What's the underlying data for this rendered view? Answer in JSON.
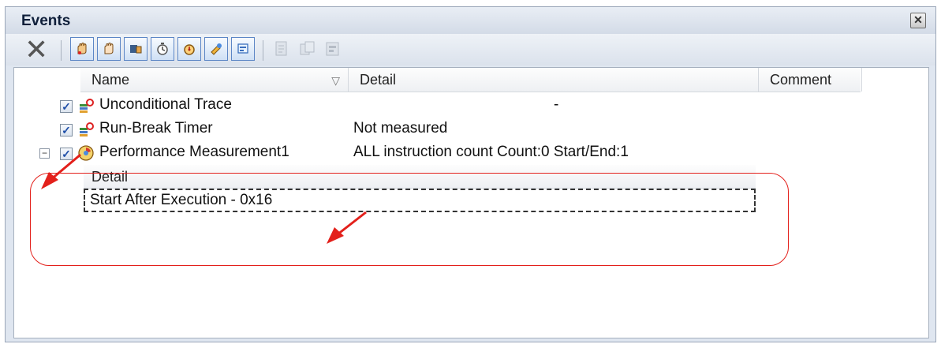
{
  "window": {
    "title": "Events",
    "close_icon": "close-icon"
  },
  "toolbar": {
    "delete_icon": "delete-icon",
    "event_buttons": [
      "hardware-break-icon",
      "software-break-icon",
      "trace-icon",
      "timer-icon",
      "performance-icon",
      "action-event-icon",
      "ram-icon"
    ],
    "disabled_buttons": [
      "edit-icon",
      "duplicate-icon",
      "properties-icon"
    ]
  },
  "columns": {
    "name": "Name",
    "detail": "Detail",
    "comment": "Comment"
  },
  "events": [
    {
      "checked": true,
      "name": "Unconditional Trace",
      "detail": "-",
      "icon": "trace-event-icon"
    },
    {
      "checked": true,
      "name": "Run-Break Timer",
      "detail": "Not measured",
      "icon": "timer-event-icon"
    },
    {
      "checked": true,
      "expanded": true,
      "name": "Performance Measurement1",
      "detail": "ALL instruction count Count:0 Start/End:1",
      "icon": "performance-event-icon"
    }
  ],
  "subgrid": {
    "header": "Detail",
    "rows": [
      "Start After Execution  - 0x16"
    ]
  },
  "colors": {
    "annotation": "#e3201b",
    "selection": "#5c86c6"
  }
}
